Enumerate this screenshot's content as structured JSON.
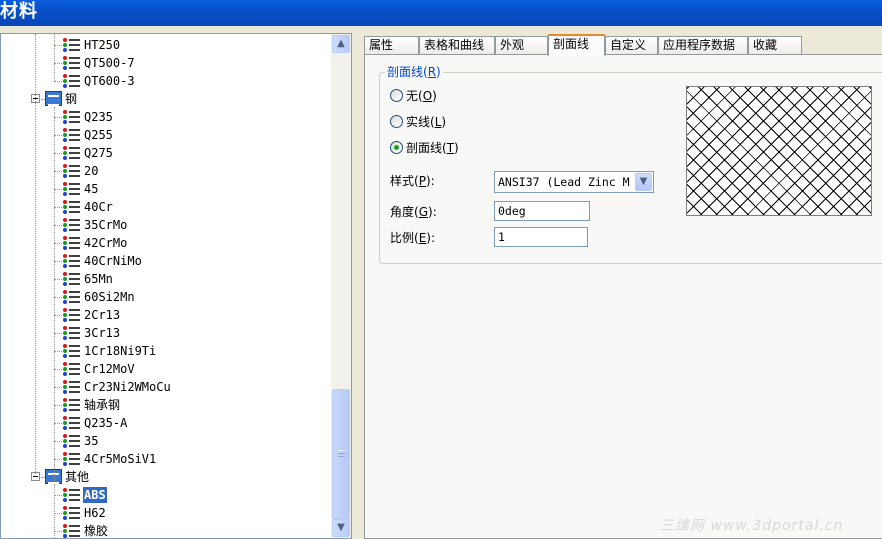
{
  "window": {
    "title": "材料"
  },
  "tree": {
    "items": [
      {
        "label": "HT250",
        "type": "material"
      },
      {
        "label": "QT500-7",
        "type": "material"
      },
      {
        "label": "QT600-3",
        "type": "material"
      },
      {
        "label": "钢",
        "type": "category",
        "expanded": true
      },
      {
        "label": "Q235",
        "type": "material"
      },
      {
        "label": "Q255",
        "type": "material"
      },
      {
        "label": "Q275",
        "type": "material"
      },
      {
        "label": "20",
        "type": "material"
      },
      {
        "label": "45",
        "type": "material"
      },
      {
        "label": "40Cr",
        "type": "material"
      },
      {
        "label": "35CrMo",
        "type": "material"
      },
      {
        "label": "42CrMo",
        "type": "material"
      },
      {
        "label": "40CrNiMo",
        "type": "material"
      },
      {
        "label": "65Mn",
        "type": "material"
      },
      {
        "label": "60Si2Mn",
        "type": "material"
      },
      {
        "label": "2Cr13",
        "type": "material"
      },
      {
        "label": "3Cr13",
        "type": "material"
      },
      {
        "label": "1Cr18Ni9Ti",
        "type": "material"
      },
      {
        "label": "Cr12MoV",
        "type": "material"
      },
      {
        "label": "Cr23Ni2WMoCu",
        "type": "material"
      },
      {
        "label": "轴承钢",
        "type": "material"
      },
      {
        "label": "Q235-A",
        "type": "material"
      },
      {
        "label": "35",
        "type": "material"
      },
      {
        "label": "4Cr5MoSiV1",
        "type": "material"
      },
      {
        "label": "其他",
        "type": "category",
        "expanded": true
      },
      {
        "label": "ABS",
        "type": "material",
        "selected": true
      },
      {
        "label": "H62",
        "type": "material"
      },
      {
        "label": "橡胶",
        "type": "material"
      }
    ]
  },
  "tabs": [
    {
      "label": "属性"
    },
    {
      "label": "表格和曲线"
    },
    {
      "label": "外观"
    },
    {
      "label": "剖面线",
      "active": true
    },
    {
      "label": "自定义"
    },
    {
      "label": "应用程序数据"
    },
    {
      "label": "收藏"
    }
  ],
  "hatch": {
    "group_label": "剖面线",
    "group_key": "R",
    "options": [
      {
        "label": "无",
        "key": "O",
        "checked": false
      },
      {
        "label": "实线",
        "key": "L",
        "checked": false
      },
      {
        "label": "剖面线",
        "key": "T",
        "checked": true
      }
    ],
    "style": {
      "label": "样式",
      "key": "P",
      "value": "ANSI37 (Lead Zinc M"
    },
    "angle": {
      "label": "角度",
      "key": "G",
      "value": "0deg"
    },
    "scale": {
      "label": "比例",
      "key": "E",
      "value": "1"
    }
  },
  "watermark": "三维网 www.3dportal.cn",
  "colors": {
    "title_bar": "#0a5ee0",
    "selection": "#316ac5",
    "active_tab": "#e68b2c",
    "group_label": "#0046d5",
    "radio_dot": "#21a121"
  }
}
